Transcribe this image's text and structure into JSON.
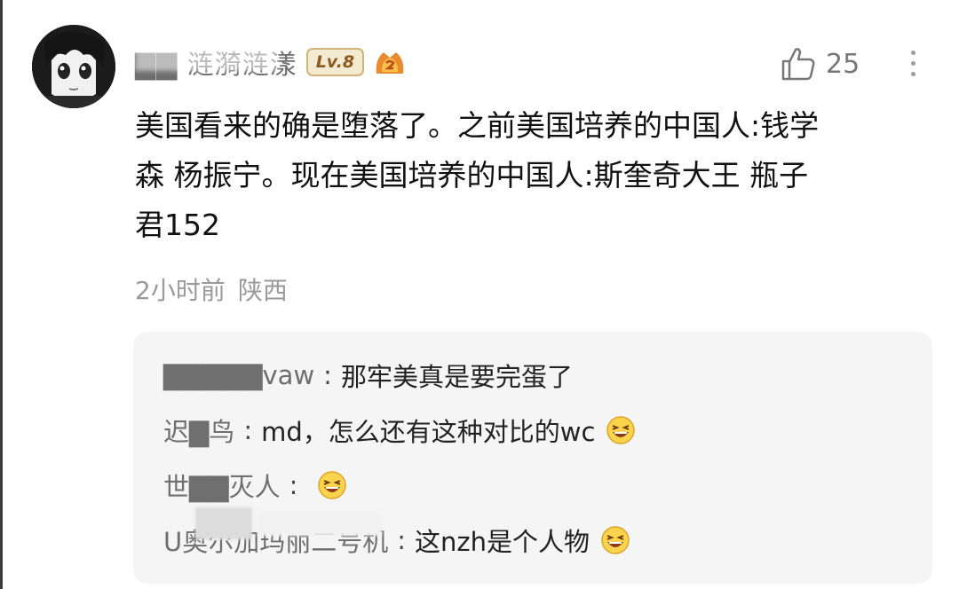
{
  "comment": {
    "username": "▇▇ 涟漪涟漾",
    "level": "Lv.8",
    "likes": "25",
    "lines": [
      "美国看来的确是堕落了。之前美国培养的中国人:钱学",
      "森 杨振宁。现在美国培养的中国人:斯奎奇大王 瓶子",
      "君152"
    ],
    "time": "2小时前",
    "location": "陕西"
  },
  "replies": [
    {
      "name": "▇▇▇▇▇vaw",
      "text": "那牢美真是要完蛋了",
      "emoji": ""
    },
    {
      "name": "迟▇鸟",
      "text": "md，怎么还有这种对比的wc",
      "emoji": "grinning-squint-emoji"
    },
    {
      "name": "世▇▇灭人",
      "text": "",
      "emoji": "grinning-squint-emoji"
    },
    {
      "name": "U奥尔加玛丽二号机",
      "text": "这nzh是个人物",
      "emoji": "grinning-squint-emoji"
    }
  ],
  "colors": {
    "text": "#111111",
    "secondary": "#9a9a9a",
    "reply_bg": "#f5f5f5",
    "badge_bg": "#f3ead2",
    "badge_text": "#8c5a1c"
  }
}
